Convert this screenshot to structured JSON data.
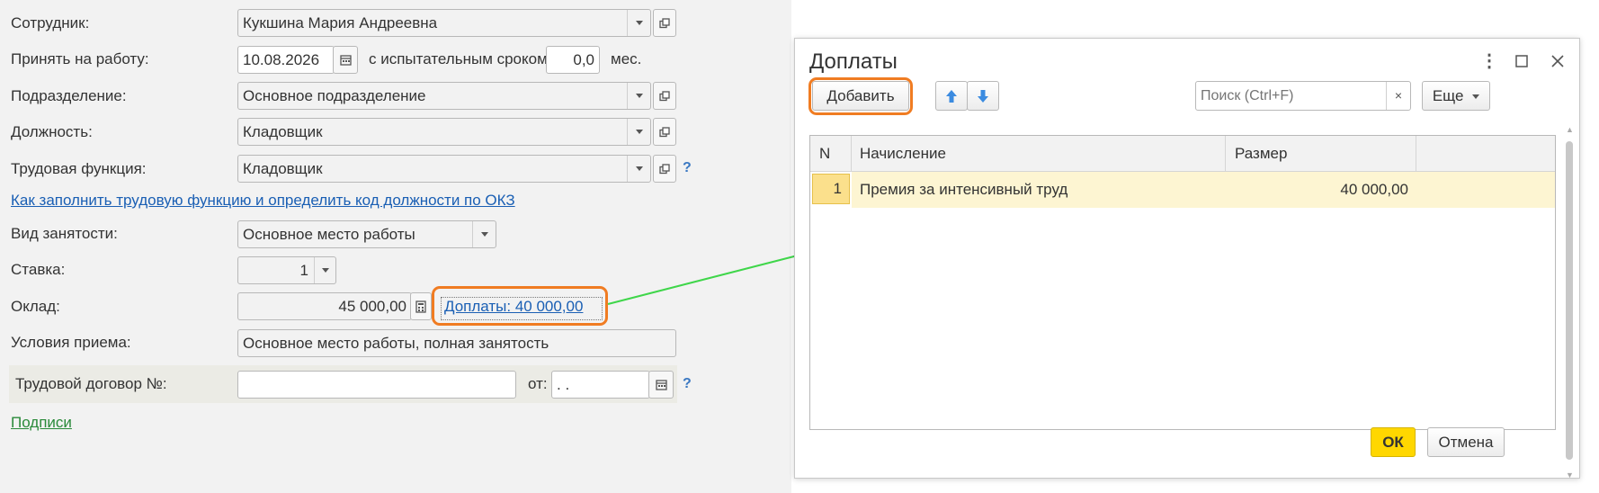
{
  "form": {
    "employee": {
      "label": "Сотрудник:",
      "value": "Кукшина Мария Андреевна"
    },
    "hire": {
      "label": "Принять на работу:",
      "date": "10.08.2026",
      "probation_label": "с испытательным сроком:",
      "probation_value": "0,0",
      "probation_unit": "мес."
    },
    "department": {
      "label": "Подразделение:",
      "value": "Основное подразделение"
    },
    "position": {
      "label": "Должность:",
      "value": "Кладовщик"
    },
    "function": {
      "label": "Трудовая функция:",
      "value": "Кладовщик"
    },
    "okz_link": "Как заполнить трудовую функцию и определить код должности по ОКЗ",
    "employment": {
      "label": "Вид занятости:",
      "value": "Основное место работы"
    },
    "rate": {
      "label": "Ставка:",
      "value": "1"
    },
    "salary": {
      "label": "Оклад:",
      "value": "45 000,00",
      "extra_link": "Доплаты: 40 000,00"
    },
    "conditions": {
      "label": "Условия приема:",
      "value": "Основное место работы, полная занятость"
    },
    "contract": {
      "label": "Трудовой договор №:",
      "number": "",
      "from_label": "от:",
      "date": " .  . "
    },
    "signatures_link": "Подписи",
    "help_mark": "?"
  },
  "dialog": {
    "title": "Доплаты",
    "add_button": "Добавить",
    "search_placeholder": "Поиск (Ctrl+F)",
    "search_clear": "×",
    "more_button": "Еще",
    "columns": {
      "n": "N",
      "accrual": "Начисление",
      "amount": "Размер"
    },
    "rows": [
      {
        "n": "1",
        "accrual": "Премия за интенсивный труд",
        "amount": "40 000,00"
      }
    ],
    "ok_button": "ОК",
    "cancel_button": "Отмена"
  },
  "colors": {
    "highlight": "#f07c22",
    "arrow": "#3fd64a",
    "ok_button": "#ffd700"
  }
}
